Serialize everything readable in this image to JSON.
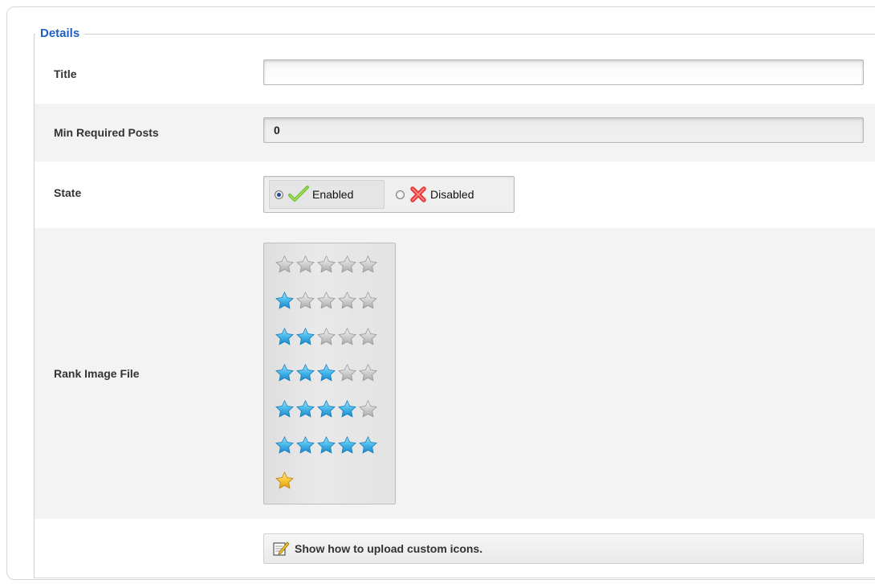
{
  "fieldset": {
    "legend": "Details"
  },
  "fields": {
    "title": {
      "label": "Title",
      "value": ""
    },
    "min_posts": {
      "label": "Min Required Posts",
      "value": "0"
    },
    "state": {
      "label": "State",
      "options": [
        {
          "label": "Enabled",
          "selected": true,
          "icon": "green-check-icon"
        },
        {
          "label": "Disabled",
          "selected": false,
          "icon": "red-x-icon"
        }
      ]
    },
    "rank_image": {
      "label": "Rank Image File",
      "options_filled_stars": [
        0,
        1,
        2,
        3,
        4,
        5
      ],
      "total_stars": 5,
      "extra_option": "single-gold-star"
    }
  },
  "help": {
    "link_text": "Show how to upload custom icons."
  },
  "colors": {
    "legend": "#1f5fbf",
    "star_filled": "#3fb3e8",
    "star_empty": "#bdbdbd",
    "star_gold": "#f0b82a",
    "check": "#6fbf2b",
    "x": "#e23a3a"
  }
}
